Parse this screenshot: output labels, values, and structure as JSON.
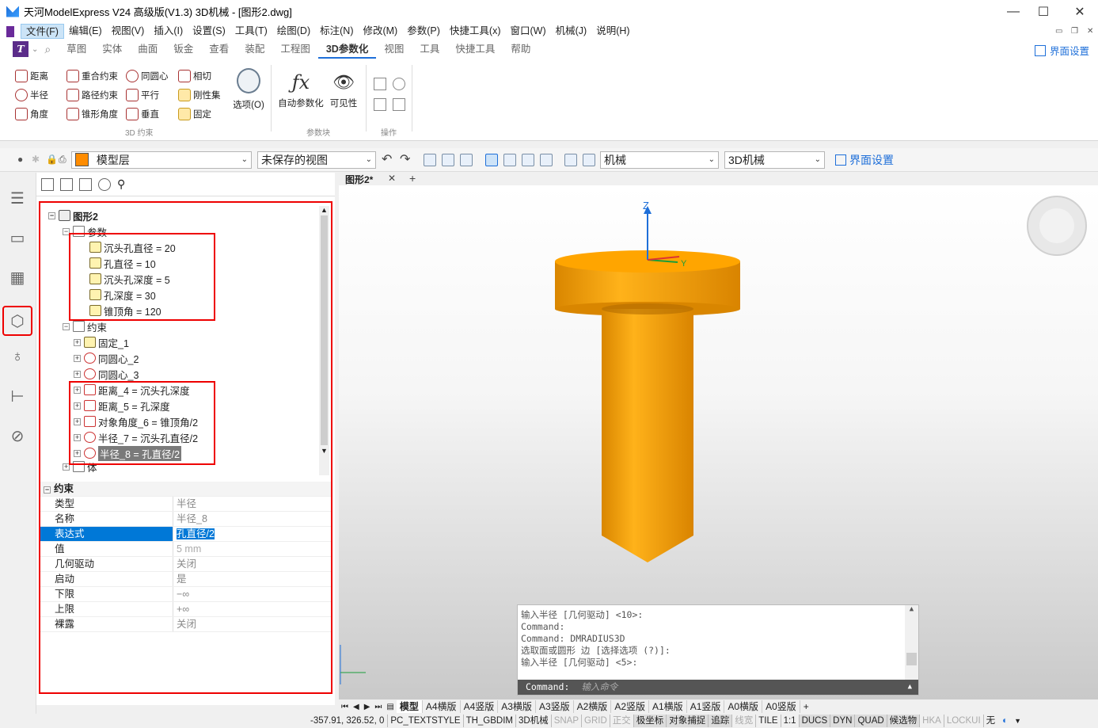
{
  "window": {
    "title": "天河ModelExpress V24 高级版(V1.3) 3D机械  - [图形2.dwg]"
  },
  "menu": [
    "文件(F)",
    "编辑(E)",
    "视图(V)",
    "插入(I)",
    "设置(S)",
    "工具(T)",
    "绘图(D)",
    "标注(N)",
    "修改(M)",
    "参数(P)",
    "快捷工具(x)",
    "窗口(W)",
    "机械(J)",
    "说明(H)"
  ],
  "ribbon_tabs": [
    "草图",
    "实体",
    "曲面",
    "钣金",
    "查看",
    "装配",
    "工程图",
    "3D参数化",
    "视图",
    "工具",
    "快捷工具",
    "帮助"
  ],
  "ribbon": {
    "ui_settings": "界面设置",
    "constraints": {
      "dist": "距离",
      "coincident": "重合约束",
      "concentric": "同圆心",
      "tangent": "相切",
      "radius": "半径",
      "path": "路径约束",
      "parallel": "平行",
      "rigid": "刚性集",
      "angle": "角度",
      "cone_angle": "锥形角度",
      "perpendicular": "垂直",
      "fixed": "固定"
    },
    "options": "选项(O)",
    "auto_param": "自动参数化",
    "visibility": "可见性",
    "group_constraint": "3D 约束",
    "group_block": "参数块",
    "group_ops": "操作"
  },
  "toolbar2": {
    "layer": "模型层",
    "view": "未保存的视图",
    "workspace": "机械",
    "profile": "3D机械",
    "ui_settings": "界面设置"
  },
  "tree": {
    "root": "图形2",
    "params_folder": "参数",
    "params": [
      "沉头孔直径 = 20",
      "孔直径 = 10",
      "沉头孔深度 = 5",
      "孔深度 = 30",
      "锥顶角 = 120"
    ],
    "constraints_folder": "约束",
    "constraints": [
      "固定_1",
      "同圆心_2",
      "同圆心_3",
      "距离_4 = 沉头孔深度",
      "距离_5 = 孔深度",
      "对象角度_6 = 锥顶角/2",
      "半径_7 = 沉头孔直径/2",
      "半径_8 = 孔直径/2"
    ],
    "body_folder": "体"
  },
  "properties": {
    "section": "约束",
    "rows": [
      {
        "k": "类型",
        "v": "半径"
      },
      {
        "k": "名称",
        "v": "半径_8"
      },
      {
        "k": "表达式",
        "v": "孔直径/2"
      },
      {
        "k": "值",
        "v": "5 mm"
      },
      {
        "k": "几何驱动",
        "v": "关闭"
      },
      {
        "k": "启动",
        "v": "是"
      },
      {
        "k": "下限",
        "v": "−∞"
      },
      {
        "k": "上限",
        "v": "+∞"
      },
      {
        "k": "裸露",
        "v": "关闭"
      }
    ]
  },
  "doc_tab": "图形2*",
  "axis": {
    "z": "Z",
    "y": "Y"
  },
  "console": {
    "lines": [
      "输入半径 [几何驱动] <10>:",
      "Command:",
      "Command: DMRADIUS3D",
      "选取面或圆形 边 [选择选项 (?)]:",
      "输入半径 [几何驱动] <5>:"
    ],
    "prompt": "Command:",
    "placeholder": "输入命令"
  },
  "layout_tabs": [
    "模型",
    "A4横版",
    "A4竖版",
    "A3横版",
    "A3竖版",
    "A2横版",
    "A2竖版",
    "A1横版",
    "A1竖版",
    "A0横版",
    "A0竖版",
    "+"
  ],
  "status": {
    "coords": "-357.91, 326.52, 0",
    "items": [
      "PC_TEXTSTYLE",
      "TH_GBDIM",
      "3D机械",
      "SNAP",
      "GRID",
      "正交",
      "极坐标",
      "对象捕捉",
      "追踪",
      "线宽",
      "TILE",
      "1:1",
      "DUCS",
      "DYN",
      "QUAD",
      "候选物",
      "HKA",
      "LOCKUI",
      "无"
    ]
  },
  "colors": {
    "part": "#f5a000",
    "accent": "#1e6fd9",
    "highlight": "#e00000"
  }
}
